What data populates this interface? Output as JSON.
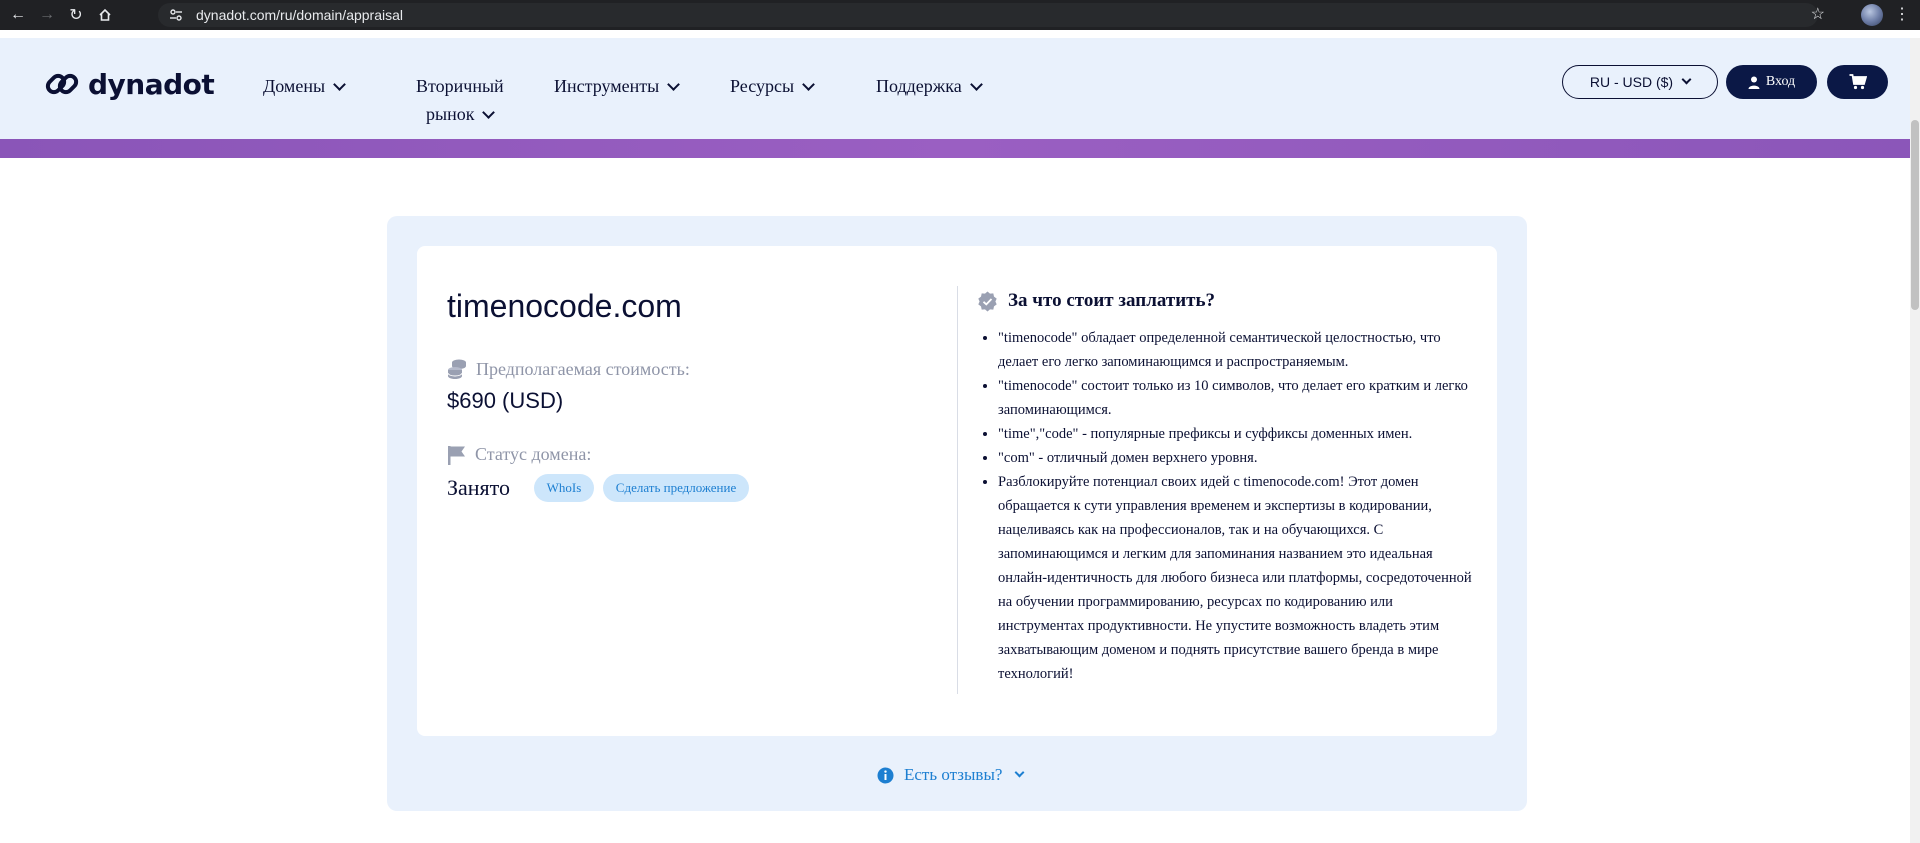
{
  "browser": {
    "url": "dynadot.com/ru/domain/appraisal"
  },
  "header": {
    "logo_text": "dynadot",
    "nav": [
      {
        "label": "Домены"
      },
      {
        "label_line1": "Вторичный",
        "label_line2": "рынок"
      },
      {
        "label": "Инструменты"
      },
      {
        "label": "Ресурсы"
      },
      {
        "label": "Поддержка"
      }
    ],
    "currency_label": "RU - USD ($)",
    "login_label": "Вход"
  },
  "appraisal": {
    "domain": "timenocode.com",
    "estimated_label": "Предполагаемая стоимость:",
    "price": "$690 (USD)",
    "status_label": "Статус домена:",
    "status_value": "Занято",
    "whois_label": "WhoIs",
    "offer_label": "Сделать предложение",
    "reasons_title": "За что стоит заплатить?",
    "reasons": [
      "\"timenocode\" обладает определенной семантической целостностью, что делает его легко запоминающимся и распространяемым.",
      "\"timenocode\" состоит только из 10 символов, что делает его кратким и легко запоминающимся.",
      "\"time\",\"code\" - популярные префиксы и суффиксы доменных имен.",
      "\"com\" - отличный домен верхнего уровня.",
      "Разблокируйте потенциал своих идей с timenocode.com! Этот домен обращается к сути управления временем и экспертизы в кодировании, нацеливаясь как на профессионалов, так и на обучающихся. С запоминающимся и легким для запоминания названием это идеальная онлайн-идентичность для любого бизнеса или платформы, сосредоточенной на обучении программированию, ресурсах по кодированию или инструментах продуктивности. Не упустите возможность владеть этим захватывающим доменом и поднять присутствие вашего бренда в мире технологий!"
    ],
    "feedback_label": "Есть отзывы?"
  },
  "colors": {
    "navy": "#0b1846",
    "header_bg": "#e9f1fc",
    "purple_band": "#9a5fc2",
    "link_blue": "#1d7fd1",
    "pill_bg": "#cde6fb"
  }
}
